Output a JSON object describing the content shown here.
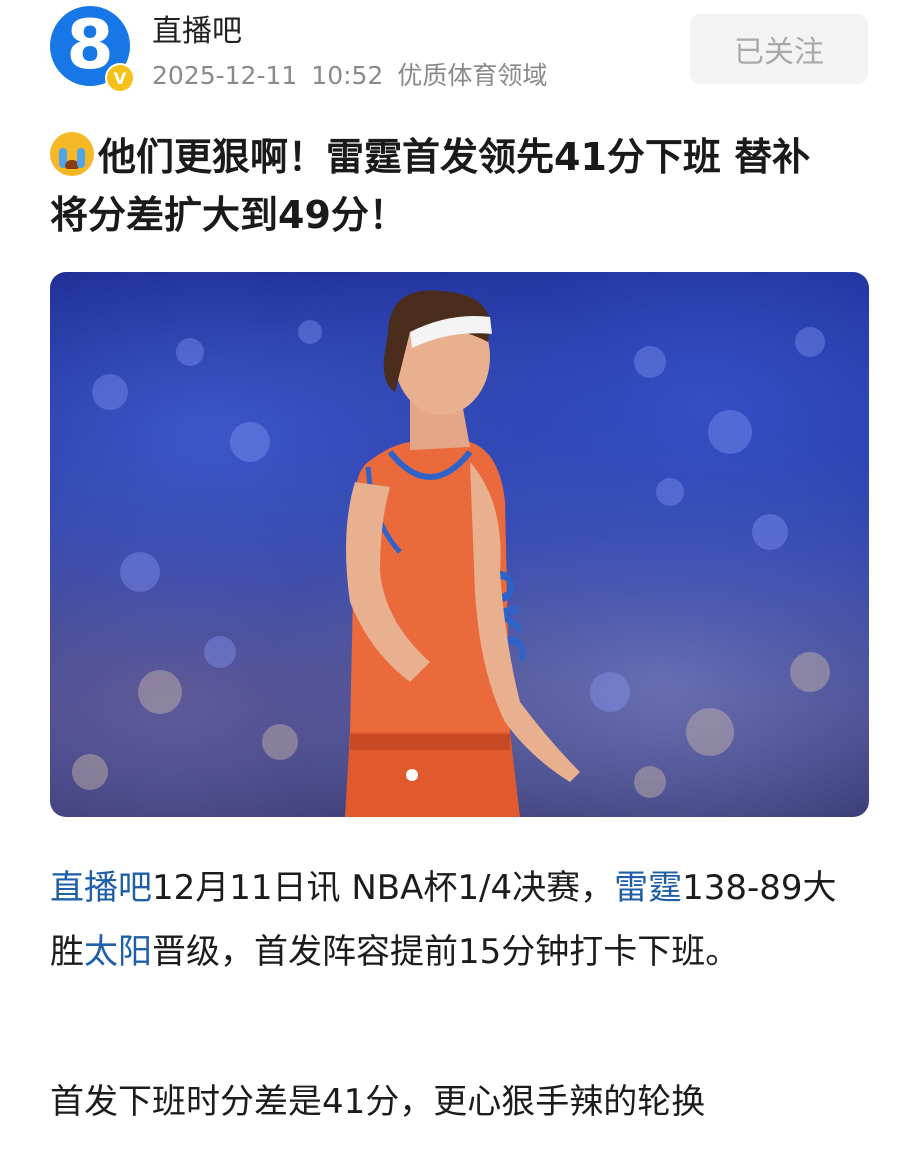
{
  "header": {
    "account_name": "直播吧",
    "date": "2025-12-11",
    "time": "10:52",
    "category": "优质体育领域",
    "follow_label": "已关注",
    "avatar_text": "8",
    "verified_badge": "V"
  },
  "article": {
    "headline_line1": "他们更狠啊！雷霆首发领先41分下班 替补",
    "headline_line2": "将分差扩大到49分！",
    "p1": {
      "source": "直播吧",
      "text1": "12月11日讯 NBA杯1/4决赛，",
      "team1": "雷霆",
      "text2": "138-89大胜",
      "team2": "太阳",
      "text3": "晋级，首发阵容提前15分钟打卡下班。"
    },
    "p2": "首发下班时分差是41分，更心狠手辣的轮换"
  },
  "colors": {
    "link": "#1f5fa8",
    "avatar_bg": "#1877e6",
    "badge": "#f5c21b",
    "jersey": "#e8653a"
  },
  "icons": {
    "verified": "verified-badge-icon",
    "emoji": "crying-face-icon"
  }
}
